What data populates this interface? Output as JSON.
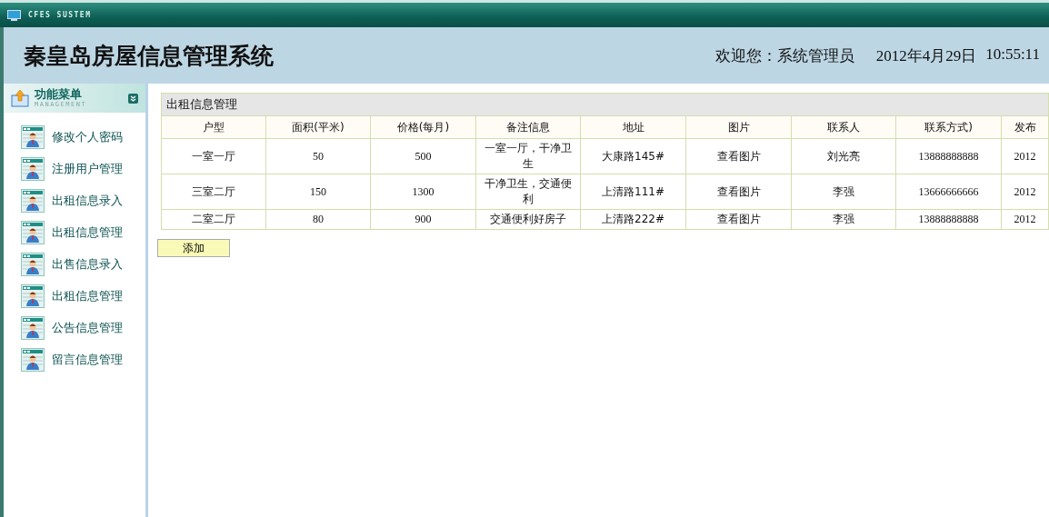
{
  "titlebar": {
    "title": "CFES SUSTEM"
  },
  "header": {
    "title": "秦皇岛房屋信息管理系统",
    "welcome": "欢迎您：系统管理员",
    "date": "2012年4月29日",
    "time": "10:55:11"
  },
  "sidebar": {
    "title": "功能菜单",
    "subtitle": "MANAGEMENT",
    "items": [
      {
        "label": "修改个人密码"
      },
      {
        "label": "注册用户管理"
      },
      {
        "label": "出租信息录入"
      },
      {
        "label": "出租信息管理"
      },
      {
        "label": "出售信息录入"
      },
      {
        "label": "出租信息管理"
      },
      {
        "label": "公告信息管理"
      },
      {
        "label": "留言信息管理"
      }
    ]
  },
  "panel": {
    "title": "出租信息管理"
  },
  "table": {
    "columns": [
      "户型",
      "面积(平米)",
      "价格(每月)",
      "备注信息",
      "地址",
      "图片",
      "联系人",
      "联系方式)",
      "发布"
    ],
    "rows": [
      [
        "一室一厅",
        "50",
        "500",
        "一室一厅，干净卫生",
        "大康路145#",
        "查看图片",
        "刘光亮",
        "13888888888",
        "2012"
      ],
      [
        "三室二厅",
        "150",
        "1300",
        "干净卫生，交通便利",
        "上清路111#",
        "查看图片",
        "李强",
        "13666666666",
        "2012"
      ],
      [
        "二室二厅",
        "80",
        "900",
        "交通便利好房子",
        "上清路222#",
        "查看图片",
        "李强",
        "13888888888",
        "2012"
      ]
    ]
  },
  "add_button": "添加"
}
